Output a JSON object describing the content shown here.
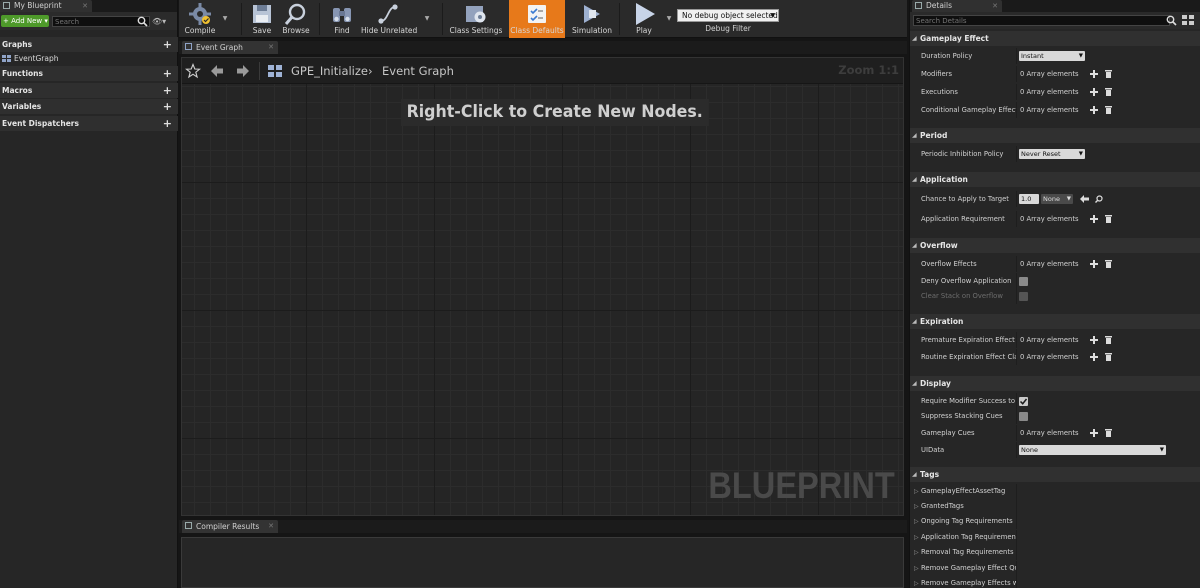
{
  "left_panel": {
    "tab_label": "My Blueprint",
    "add_new_label": "+ Add New ▾",
    "search_placeholder": "Search",
    "categories": {
      "graphs": "Graphs",
      "functions": "Functions",
      "macros": "Macros",
      "variables": "Variables",
      "event_dispatchers": "Event Dispatchers"
    },
    "graph_item": "EventGraph"
  },
  "toolbar": {
    "compile": "Compile",
    "save": "Save",
    "browse": "Browse",
    "find": "Find",
    "hide_unrelated": "Hide Unrelated",
    "class_settings": "Class Settings",
    "class_defaults": "Class Defaults",
    "simulation": "Simulation",
    "play": "Play",
    "debug_object": "No debug object selected",
    "debug_filter": "Debug Filter",
    "accent_color": "#e7791a"
  },
  "graph": {
    "tab_label": "Event Graph",
    "breadcrumb_blueprint": "GPE_Initialize",
    "breadcrumb_graph": "Event Graph",
    "zoom": "Zoom 1:1",
    "hint": "Right-Click to Create New Nodes.",
    "watermark": "BLUEPRINT"
  },
  "compiler": {
    "tab_label": "Compiler Results"
  },
  "details": {
    "tab_label": "Details",
    "search_placeholder": "Search Details",
    "sections": {
      "gameplay_effect": "Gameplay Effect",
      "period": "Period",
      "application": "Application",
      "overflow": "Overflow",
      "expiration": "Expiration",
      "display": "Display",
      "tags": "Tags"
    },
    "rows": {
      "duration_policy": "Duration Policy",
      "duration_value": "Instant",
      "modifiers": "Modifiers",
      "executions": "Executions",
      "conditional_effects": "Conditional Gameplay Effects",
      "periodic_policy": "Periodic Inhibition Policy",
      "periodic_value": "Never Reset",
      "chance_to_apply": "Chance to Apply to Target",
      "chance_value": "1.0",
      "chance_curve": "None",
      "application_requirement": "Application Requirement",
      "overflow_effects": "Overflow Effects",
      "deny_overflow": "Deny Overflow Application",
      "clear_stack": "Clear Stack on Overflow",
      "premature_expiration": "Premature Expiration Effect Classes",
      "routine_expiration": "Routine Expiration Effect Classes",
      "require_modifier": "Require Modifier Success to Trigger Cues",
      "suppress_stacking": "Suppress Stacking Cues",
      "gameplay_cues": "Gameplay Cues",
      "uidata": "UIData",
      "uidata_value": "None"
    },
    "array_text": "0 Array elements",
    "tags": [
      "GameplayEffectAssetTag",
      "GrantedTags",
      "Ongoing Tag Requirements",
      "Application Tag Requirements",
      "Removal Tag Requirements",
      "Remove Gameplay Effect Query",
      "Remove Gameplay Effects with Tags"
    ]
  }
}
